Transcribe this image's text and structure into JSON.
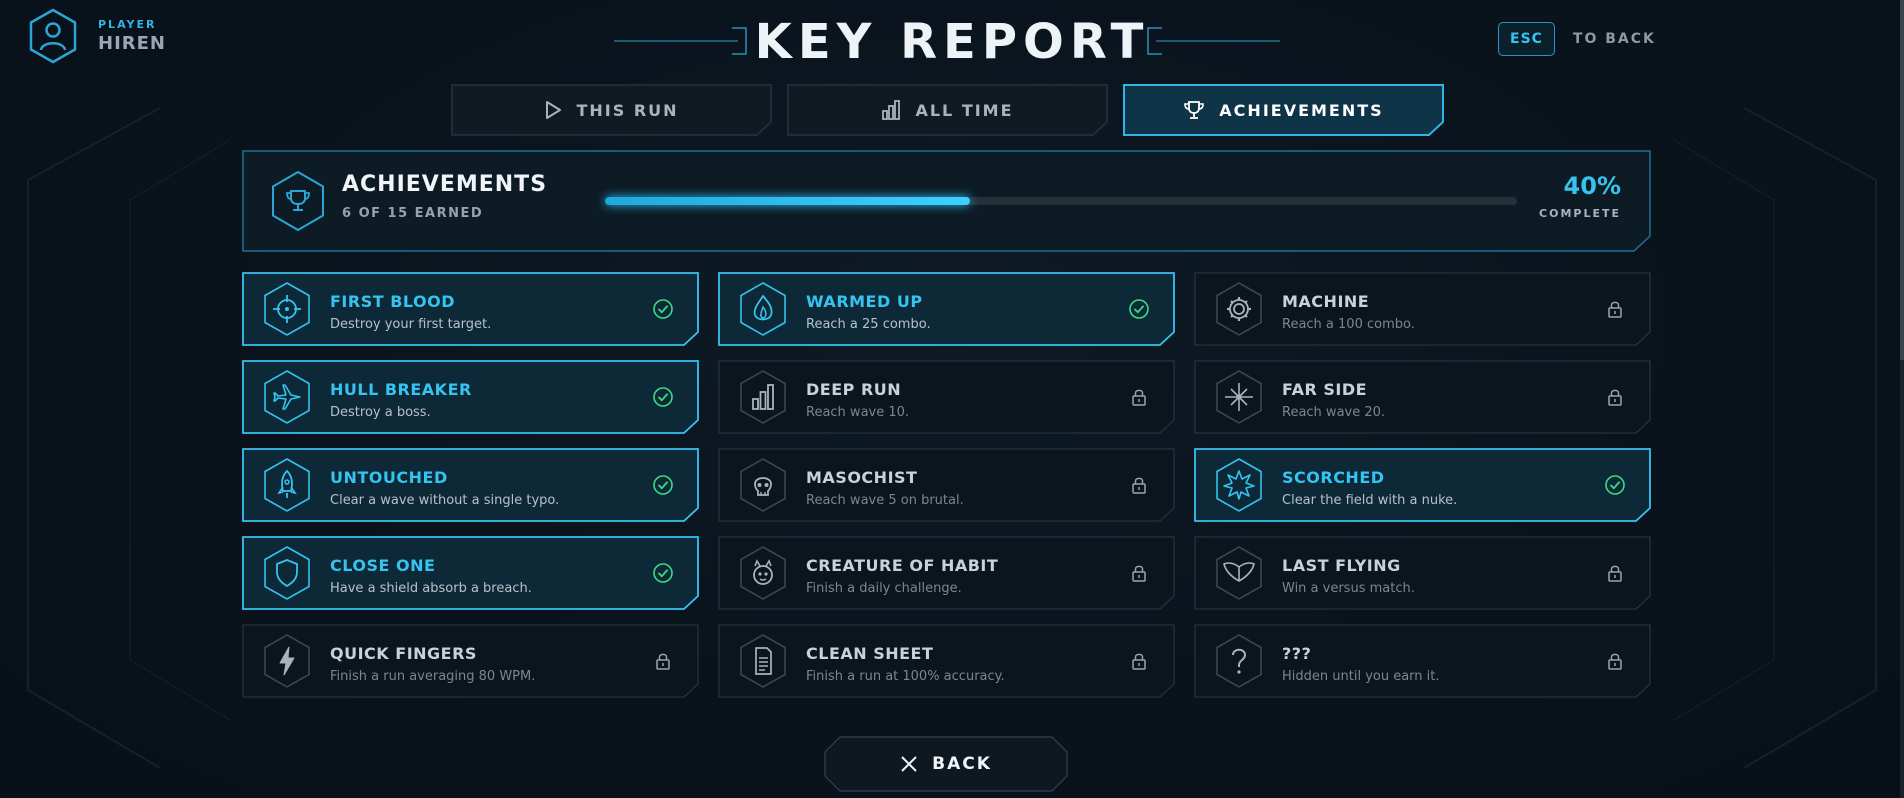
{
  "player": {
    "label": "PLAYER",
    "name": "HIREN",
    "icon": "user-icon"
  },
  "title": "KEY REPORT",
  "esc": {
    "key": "ESC",
    "label": "TO BACK"
  },
  "tabs": [
    {
      "label": "THIS RUN",
      "icon": "play-icon",
      "active": false
    },
    {
      "label": "ALL TIME",
      "icon": "bar-chart-icon",
      "active": false
    },
    {
      "label": "ACHIEVEMENTS",
      "icon": "trophy-icon",
      "active": true
    }
  ],
  "summary": {
    "title": "ACHIEVEMENTS",
    "subtitle": "6 OF 15 EARNED",
    "percent_label": "40%",
    "progress": 0.4,
    "complete_label": "COMPLETE",
    "icon": "trophy-icon"
  },
  "achievements": [
    {
      "title": "FIRST BLOOD",
      "desc": "Destroy your first target.",
      "icon": "crosshair-icon",
      "earned": true
    },
    {
      "title": "WARMED UP",
      "desc": "Reach a 25 combo.",
      "icon": "flame-icon",
      "earned": true
    },
    {
      "title": "MACHINE",
      "desc": "Reach a 100 combo.",
      "icon": "gear-icon",
      "earned": false
    },
    {
      "title": "HULL BREAKER",
      "desc": "Destroy a boss.",
      "icon": "jet-icon",
      "earned": true
    },
    {
      "title": "DEEP RUN",
      "desc": "Reach wave 10.",
      "icon": "bars-icon",
      "earned": false
    },
    {
      "title": "FAR SIDE",
      "desc": "Reach wave 20.",
      "icon": "starburst-icon",
      "earned": false
    },
    {
      "title": "UNTOUCHED",
      "desc": "Clear a wave without a single typo.",
      "icon": "rocket-icon",
      "earned": true
    },
    {
      "title": "MASOCHIST",
      "desc": "Reach wave 5 on brutal.",
      "icon": "skull-icon",
      "earned": false
    },
    {
      "title": "SCORCHED",
      "desc": "Clear the field with a nuke.",
      "icon": "explosion-icon",
      "earned": true
    },
    {
      "title": "CLOSE ONE",
      "desc": "Have a shield absorb a breach.",
      "icon": "shield-icon",
      "earned": true
    },
    {
      "title": "CREATURE OF HABIT",
      "desc": "Finish a daily challenge.",
      "icon": "creature-icon",
      "earned": false
    },
    {
      "title": "LAST FLYING",
      "desc": "Win a versus match.",
      "icon": "wings-icon",
      "earned": false
    },
    {
      "title": "QUICK FINGERS",
      "desc": "Finish a run averaging 80 WPM.",
      "icon": "lightning-icon",
      "earned": false
    },
    {
      "title": "CLEAN SHEET",
      "desc": "Finish a run at 100% accuracy.",
      "icon": "document-icon",
      "earned": false
    },
    {
      "title": "???",
      "desc": "Hidden until you earn it.",
      "icon": "question-icon",
      "earned": false
    }
  ],
  "back_label": "BACK",
  "colors": {
    "accent": "#35c3f0",
    "success": "#3ddc84",
    "background": "#0a131c",
    "locked_border": "#26323c"
  }
}
